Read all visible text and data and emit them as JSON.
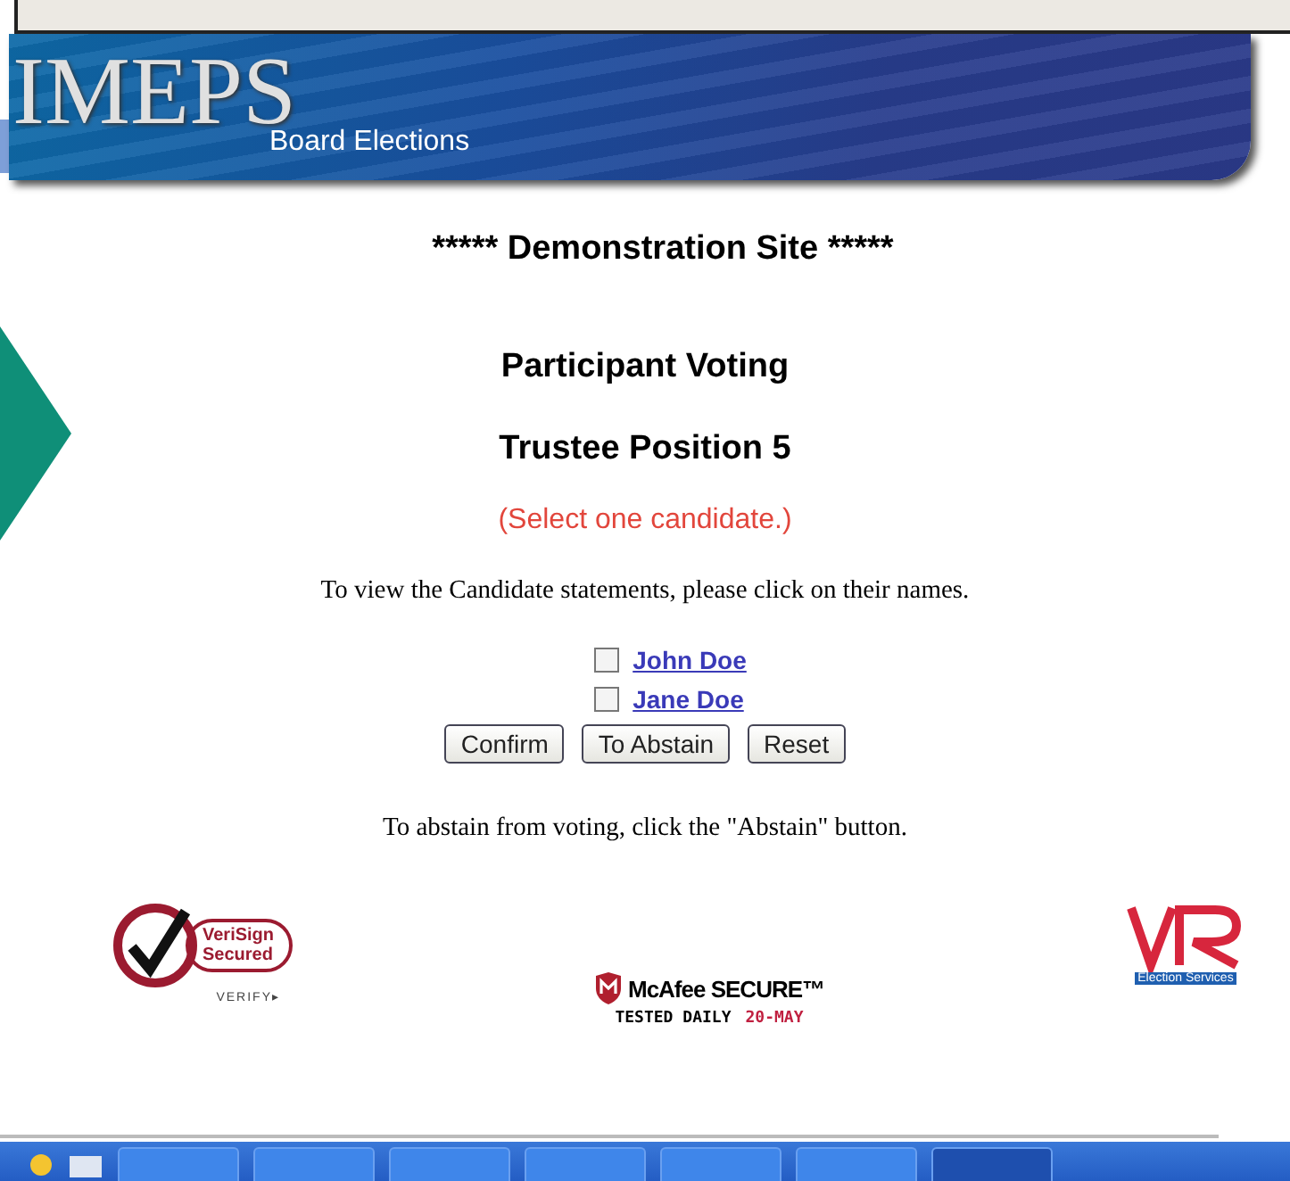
{
  "banner": {
    "logo": "IMEPS",
    "subtitle": "Board Elections"
  },
  "heading": "***** Demonstration Site *****",
  "title": "Participant Voting",
  "position": "Trustee Position 5",
  "instruction": "(Select one candidate.)",
  "statement_note": "To view the Candidate statements, please click on their names.",
  "candidates": [
    {
      "name": "John Doe",
      "checked": false
    },
    {
      "name": "Jane Doe",
      "checked": false
    }
  ],
  "buttons": [
    "Confirm",
    "To Abstain",
    "Reset"
  ],
  "abstain_note": "To abstain from voting, click the \"Abstain\" button.",
  "badges": {
    "verisign": {
      "line1": "VeriSign",
      "line2": "Secured",
      "verify": "VERIFY▸"
    },
    "mcafee": {
      "brand": "McAfee SECURE™",
      "tested": "TESTED DAILY",
      "date": "20-MAY"
    },
    "vr": {
      "caption": "Election Services"
    }
  },
  "taskbar": {
    "buttons": [
      {
        "selected": false
      },
      {
        "selected": false
      },
      {
        "selected": false
      },
      {
        "selected": false
      },
      {
        "selected": false
      },
      {
        "selected": false
      },
      {
        "selected": true
      }
    ]
  }
}
